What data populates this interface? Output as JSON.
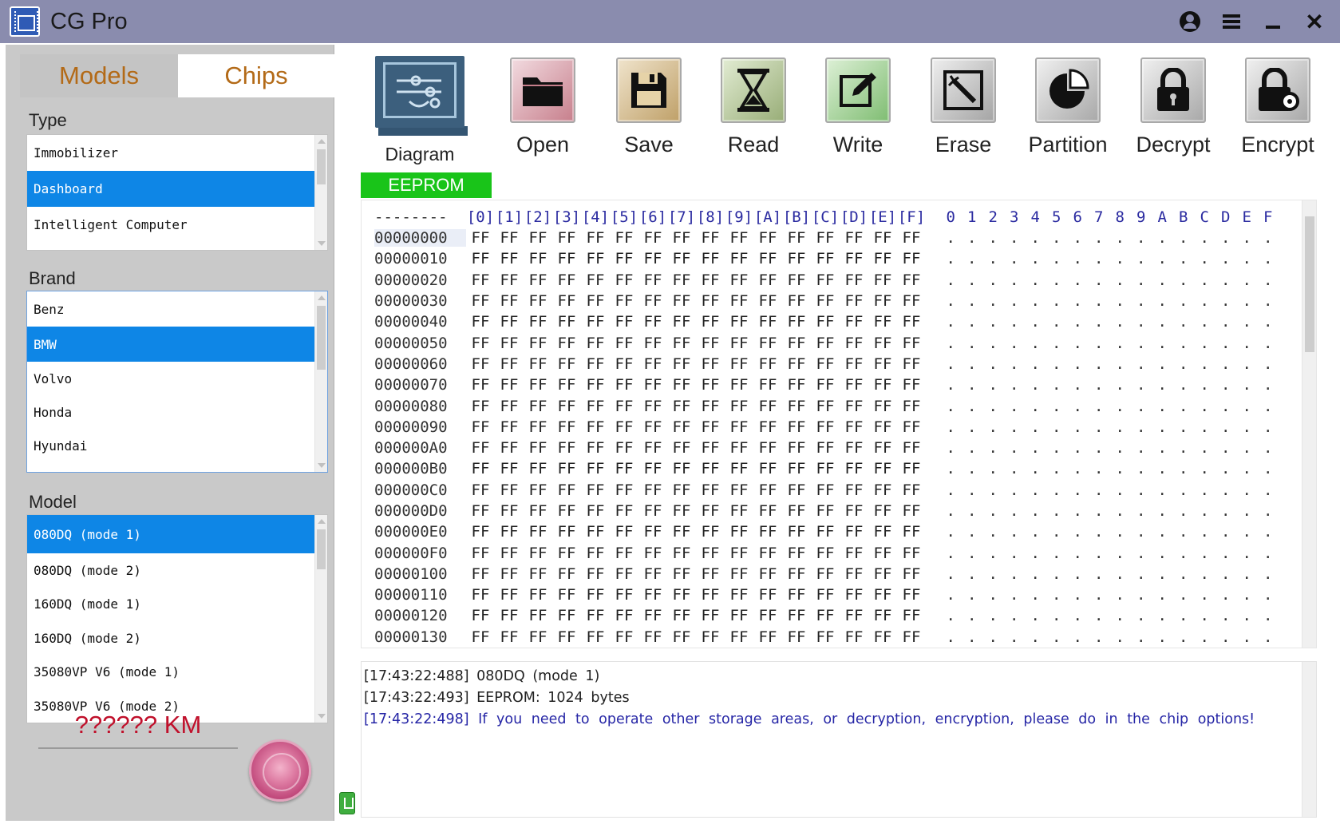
{
  "window": {
    "title": "CG Pro"
  },
  "tabs": {
    "models": "Models",
    "chips": "Chips"
  },
  "type_section": {
    "label": "Type",
    "items": [
      "Immobilizer",
      "Dashboard",
      "Intelligent Computer"
    ],
    "selected": "Dashboard"
  },
  "brand_section": {
    "label": "Brand",
    "items": [
      "Benz",
      "BMW",
      "Volvo",
      "Honda",
      "Hyundai"
    ],
    "selected": "BMW"
  },
  "model_section": {
    "label": "Model",
    "items": [
      "080DQ  (mode 1)",
      "080DQ  (mode 2)",
      "160DQ  (mode 1)",
      "160DQ  (mode 2)",
      "35080VP V6  (mode 1)",
      "35080VP V6  (mode 2)"
    ],
    "selected": "080DQ  (mode 1)"
  },
  "mileage": {
    "value": "?????? KM"
  },
  "toolbar": {
    "diagram": "Diagram",
    "open": "Open",
    "save": "Save",
    "read": "Read",
    "write": "Write",
    "erase": "Erase",
    "partition": "Partition",
    "decrypt": "Decrypt",
    "encrypt": "Encrypt"
  },
  "memory_tab": "EEPROM",
  "hex_view": {
    "corner": "--------",
    "columns": [
      "[0]",
      "[1]",
      "[2]",
      "[3]",
      "[4]",
      "[5]",
      "[6]",
      "[7]",
      "[8]",
      "[9]",
      "[A]",
      "[B]",
      "[C]",
      "[D]",
      "[E]",
      "[F]"
    ],
    "ascii_columns": [
      "0",
      "1",
      "2",
      "3",
      "4",
      "5",
      "6",
      "7",
      "8",
      "9",
      "A",
      "B",
      "C",
      "D",
      "E",
      "F"
    ],
    "addresses": [
      "00000000",
      "00000010",
      "00000020",
      "00000030",
      "00000040",
      "00000050",
      "00000060",
      "00000070",
      "00000080",
      "00000090",
      "000000A0",
      "000000B0",
      "000000C0",
      "000000D0",
      "000000E0",
      "000000F0",
      "00000100",
      "00000110",
      "00000120",
      "00000130"
    ],
    "fill_byte": "FF",
    "ascii_char": "."
  },
  "log": [
    {
      "time": "[17:43:22:488]",
      "text": "080DQ  (mode 1)",
      "kind": "info"
    },
    {
      "time": "[17:43:22:493]",
      "text": "EEPROM: 1024 bytes",
      "kind": "info"
    },
    {
      "time": "[17:43:22:498]",
      "text": "If you need to operate other storage areas, or decryption, encryption, please do in the chip options!",
      "kind": "note"
    }
  ],
  "colors": {
    "titlebar": "#8a8cae",
    "selection": "#0e86e6",
    "eeprom_tab": "#19c419",
    "tab_text": "#b36a17",
    "mileage_text": "#c0102b",
    "hex_header": "#2a2aa0",
    "log_note": "#2626a6"
  },
  "icons": {
    "open": "folder-icon",
    "save": "floppy-disk-icon",
    "read": "hourglass-icon",
    "write": "pencil-edit-icon",
    "erase": "magic-wand-icon",
    "partition": "pie-chart-icon",
    "decrypt": "padlock-icon",
    "encrypt": "padlock-gear-icon"
  }
}
